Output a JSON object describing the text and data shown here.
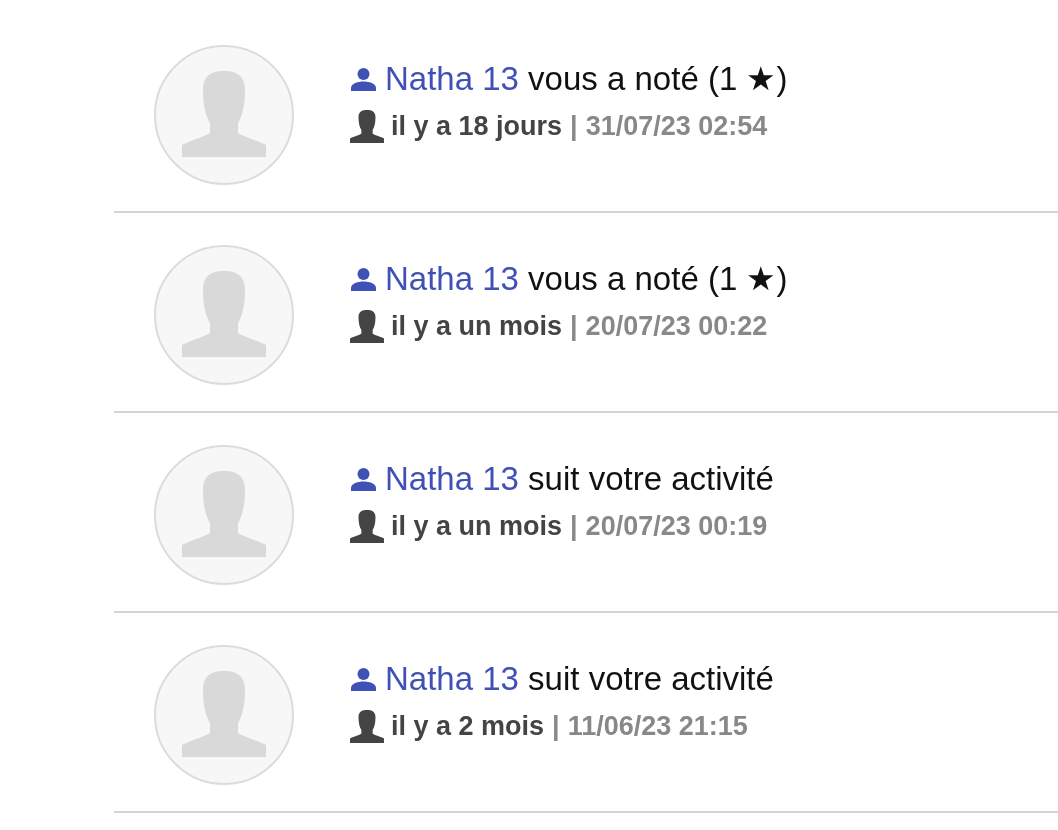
{
  "notifications": [
    {
      "user": "Natha 13",
      "action": "vous a noté (1 ★)",
      "relative_time": "il y a 18 jours",
      "separator": "|",
      "timestamp": "31/07/23 02:54"
    },
    {
      "user": "Natha 13",
      "action": "vous a noté (1 ★)",
      "relative_time": "il y a un mois",
      "separator": "|",
      "timestamp": "20/07/23 00:22"
    },
    {
      "user": "Natha 13",
      "action": "suit votre activité",
      "relative_time": "il y a un mois",
      "separator": "|",
      "timestamp": "20/07/23 00:19"
    },
    {
      "user": "Natha 13",
      "action": "suit votre activité",
      "relative_time": "il y a 2 mois",
      "separator": "|",
      "timestamp": "11/06/23 21:15"
    }
  ]
}
